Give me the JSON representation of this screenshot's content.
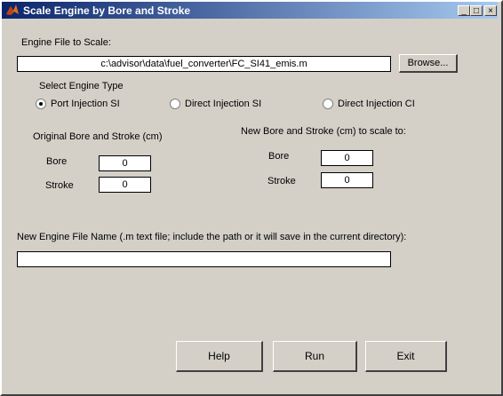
{
  "window": {
    "title": "Scale Engine by Bore and Stroke",
    "controls": {
      "minimize": "_",
      "maximize": "□",
      "close": "×"
    }
  },
  "file": {
    "label": "Engine File to Scale:",
    "path": "c:\\advisor\\data\\fuel_converter\\FC_SI41_emis.m",
    "browse_label": "Browse..."
  },
  "engine_type": {
    "label": "Select Engine Type",
    "options": [
      "Port Injection SI",
      "Direct Injection SI",
      "Direct Injection CI"
    ],
    "selected": "Port Injection SI"
  },
  "original": {
    "heading": "Original Bore and Stroke (cm)",
    "bore_label": "Bore",
    "bore_value": "0",
    "stroke_label": "Stroke",
    "stroke_value": "0"
  },
  "new": {
    "heading": "New Bore and Stroke (cm) to scale to:",
    "bore_label": "Bore",
    "bore_value": "0",
    "stroke_label": "Stroke",
    "stroke_value": "0"
  },
  "new_file": {
    "label": "New Engine File Name (.m text file; include the path or it will save in the current directory):",
    "value": ""
  },
  "buttons": {
    "help": "Help",
    "run": "Run",
    "exit": "Exit"
  }
}
